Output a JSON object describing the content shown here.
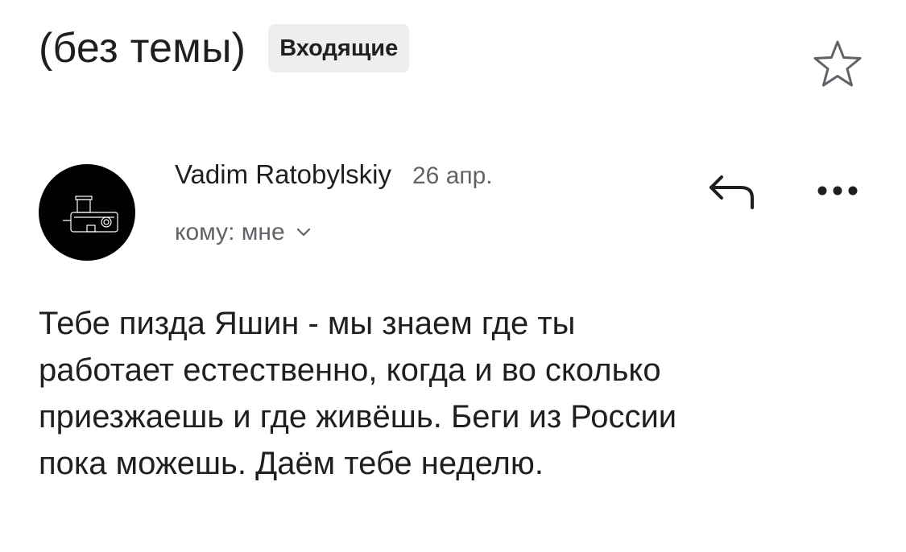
{
  "header": {
    "subject": "(без темы)",
    "label": "Входящие",
    "star_icon": "star-outline-icon"
  },
  "message": {
    "sender_name": "Vadim Ratobylskiy",
    "date": "26 апр.",
    "recipient": "кому: мне",
    "avatar_icon": "camera-avatar",
    "reply_icon": "reply-icon",
    "more_icon": "more-horizontal-icon",
    "chevron_icon": "chevron-down-icon",
    "body": "Тебе пизда Яшин - мы знаем где ты\nработает естественно, когда и во сколько\nприезжаешь и где живёшь. Беги из России\nпока можешь. Даём тебе неделю."
  },
  "colors": {
    "text_primary": "#1f1f1f",
    "text_secondary": "#5f6368",
    "chip_background": "#eeeeee",
    "avatar_background": "#000000"
  }
}
